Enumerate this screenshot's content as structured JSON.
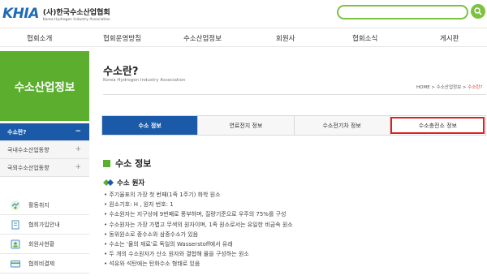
{
  "header": {
    "logo_mark": "KHIA",
    "logo_title": "(사)한국수소산업협회",
    "logo_sub": "Korea Hydrogen Industry Association",
    "search_placeholder": ""
  },
  "nav": [
    "협회소개",
    "협회운영방침",
    "수소산업정보",
    "회원사",
    "협회소식",
    "게시판"
  ],
  "sidebar": {
    "banner": "수소산업정보",
    "items": [
      {
        "label": "수소란?",
        "sign": "−"
      },
      {
        "label": "국내수소산업동향",
        "sign": "+"
      },
      {
        "label": "국외수소산업동향",
        "sign": "+"
      }
    ],
    "quick": [
      {
        "label": "활동취지",
        "icon": "handshake-icon"
      },
      {
        "label": "협회가입안내",
        "icon": "document-icon"
      },
      {
        "label": "회원사현황",
        "icon": "members-icon"
      },
      {
        "label": "협회비결제",
        "icon": "card-icon"
      }
    ]
  },
  "page": {
    "title": "수소란?",
    "subtitle": "Korea Hydrogen Industry Association",
    "breadcrumb": {
      "home": "HOME",
      "sep": " > ",
      "parent": "수소산업정보",
      "current": "수소란?"
    }
  },
  "tabs": [
    "수소 정보",
    "연료전지 정보",
    "수소전기차 정보",
    "수소충전소 정보"
  ],
  "content": {
    "section_title": "수소 정보",
    "sub_title": "수소 원자",
    "bullets": [
      "주기율표의 가장 첫 번째(1족 1주기) 화학 원소",
      "원소기호: H , 원자 번호: 1",
      "수소원자는 지구상에 9번째로 풍부하며, 질량기준으로 우주의 75%를 구성",
      "수소원자는 가장 가볍고 무색의 원자이며, 1족 원소로서는 유일한 비금속 원소",
      "동위원소로 중수소와 삼중수소가 있음",
      "수소는 '물의 재료'로 독일의 Wasserstoff에서 유래",
      "두 개의 수소원자가 산소 원자와 결합해 물을 구성하는 원소",
      "석유와 석탄에는 탄화수소 형태로 있음"
    ]
  },
  "colors": {
    "brand_green": "#5cae2e",
    "brand_blue": "#1b5aa8",
    "highlight_red": "#e02020"
  }
}
